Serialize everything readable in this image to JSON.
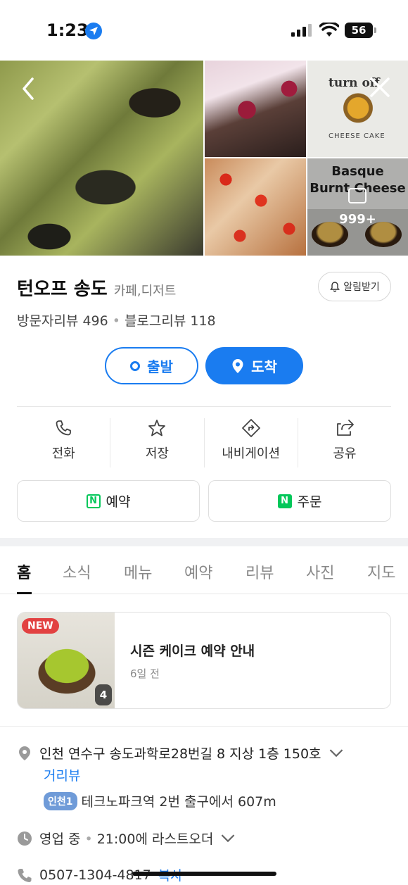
{
  "status_bar": {
    "time": "1:23",
    "battery": "56"
  },
  "photos": {
    "logo_text": "turn off",
    "logo_subtext": "CHEESE CAKE",
    "basque_line1": "Basque",
    "basque_line2": "Burnt Cheese",
    "photo_count": "999+"
  },
  "place": {
    "name": "턴오프 송도",
    "category": "카페,디저트",
    "alarm_label": "알림받기",
    "visitor_reviews": "방문자리뷰 496",
    "blog_reviews": "블로그리뷰 118"
  },
  "route": {
    "start_label": "출발",
    "arrive_label": "도착"
  },
  "actions": [
    {
      "label": "전화"
    },
    {
      "label": "저장"
    },
    {
      "label": "내비게이션"
    },
    {
      "label": "공유"
    }
  ],
  "booking": {
    "reserve_label": "예약",
    "order_label": "주문"
  },
  "tabs": [
    "홈",
    "소식",
    "메뉴",
    "예약",
    "리뷰",
    "사진",
    "지도"
  ],
  "news": {
    "badge": "NEW",
    "image_count": "4",
    "title": "시즌 케이크 예약 안내",
    "time": "6일 전"
  },
  "details": {
    "address": "인천 연수구 송도과학로28번길 8 지상 1층 150호",
    "street_view": "거리뷰",
    "subway_line": "인천1",
    "subway_directions": "테크노파크역 2번 출구에서 607m",
    "hours": "영업 중",
    "last_order": "21:00에 라스트오더",
    "phone": "0507-1304-4817",
    "copy_label": "복사"
  },
  "colors": {
    "primary": "#1a7cf0",
    "naver_green": "#03c75a",
    "new_badge": "#e24141"
  }
}
